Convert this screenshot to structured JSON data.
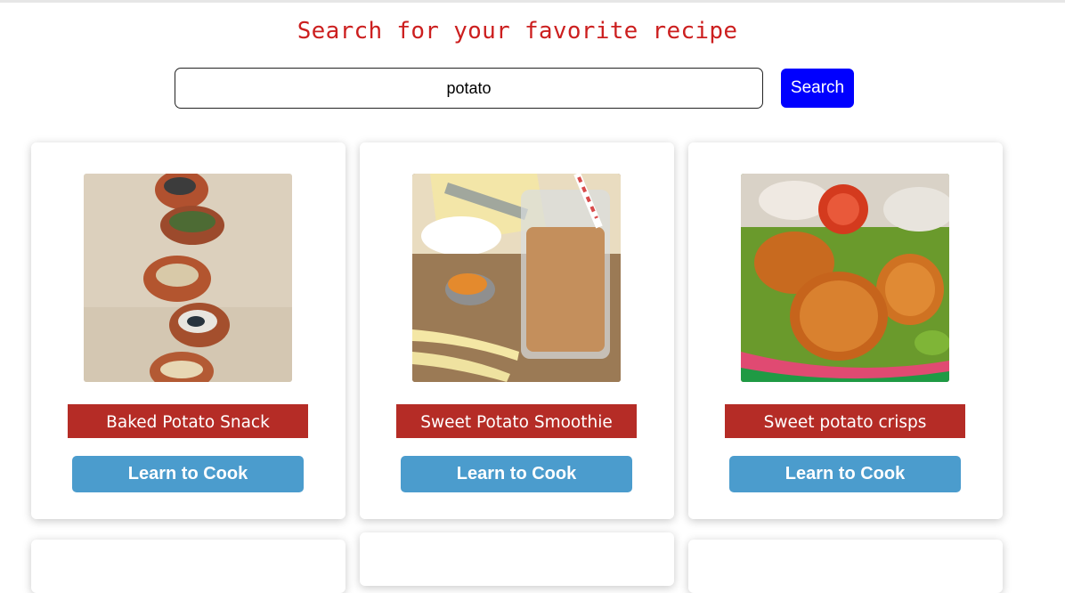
{
  "header": {
    "title": "Search for your favorite recipe"
  },
  "search": {
    "value": "potato",
    "button_label": "Search"
  },
  "recipes": [
    {
      "title": "Baked Potato Snack",
      "button_label": "Learn to Cook"
    },
    {
      "title": "Sweet Potato Smoothie",
      "button_label": "Learn to Cook"
    },
    {
      "title": "Sweet potato crisps",
      "button_label": "Learn to Cook"
    }
  ],
  "colors": {
    "title_red": "#cc1f1f",
    "search_button_blue": "#0000ff",
    "recipe_title_bg": "#b52c26",
    "learn_button_bg": "#4b9ccd"
  }
}
